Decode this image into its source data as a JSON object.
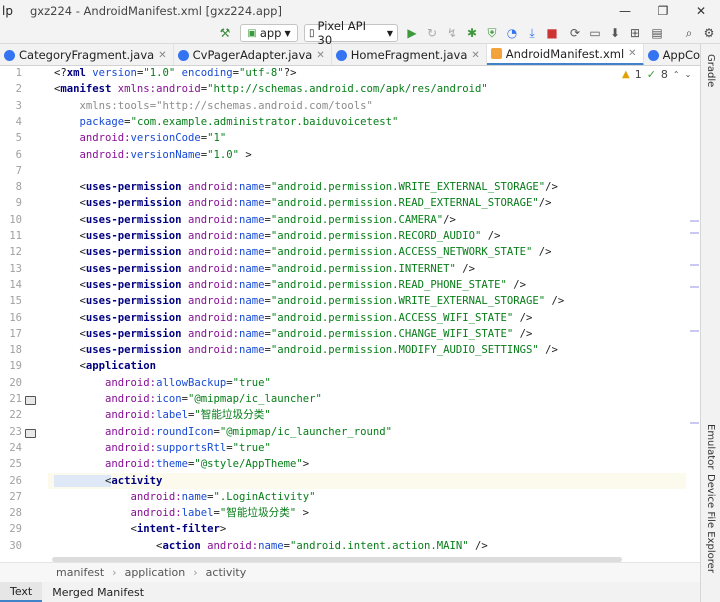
{
  "title_bar": {
    "menu_fragment": "lp",
    "window_title": "gxz224 - AndroidManifest.xml [gxz224.app]",
    "controls": [
      "minimize",
      "maximize",
      "close"
    ]
  },
  "toolbar": {
    "run_config": "app",
    "device": "Pixel API 30"
  },
  "tabs": [
    {
      "label": "CategoryFragment.java",
      "icon": "class-icon",
      "active": false
    },
    {
      "label": "CvPagerAdapter.java",
      "icon": "class-icon",
      "active": false
    },
    {
      "label": "HomeFragment.java",
      "icon": "class-icon",
      "active": false
    },
    {
      "label": "AndroidManifest.xml",
      "icon": "xml-icon",
      "active": true
    },
    {
      "label": "AppCompatPreferenceActi",
      "icon": "class-icon",
      "active": false
    }
  ],
  "right_strip": {
    "top": "Gradle",
    "emulator": "Emulator",
    "explorer": "Device File Explorer"
  },
  "inspections": {
    "warnings": "1",
    "ok": "8"
  },
  "code_lines": [
    {
      "n": "1",
      "img": false,
      "tokens": [
        [
          "p",
          "<?"
        ],
        [
          "tag",
          "xml "
        ],
        [
          "attr",
          "version"
        ],
        [
          "p",
          "="
        ],
        [
          "val",
          "\"1.0\" "
        ],
        [
          "attr",
          "encoding"
        ],
        [
          "p",
          "="
        ],
        [
          "val",
          "\"utf-8\""
        ],
        [
          "p",
          "?>"
        ]
      ]
    },
    {
      "n": "2",
      "img": false,
      "tokens": [
        [
          "p",
          "<"
        ],
        [
          "tag",
          "manifest "
        ],
        [
          "ns",
          "xmlns:android"
        ],
        [
          "p",
          "="
        ],
        [
          "val",
          "\"http://schemas.android.com/apk/res/android\""
        ]
      ]
    },
    {
      "n": "3",
      "img": false,
      "tokens": [
        [
          "p",
          "    "
        ],
        [
          "gray",
          "xmlns:tools"
        ],
        [
          "gray",
          "="
        ],
        [
          "gray",
          "\"http://schemas.android.com/tools\""
        ]
      ]
    },
    {
      "n": "4",
      "img": false,
      "tokens": [
        [
          "p",
          "    "
        ],
        [
          "attr",
          "package"
        ],
        [
          "p",
          "="
        ],
        [
          "val",
          "\"com.example.administrator.baiduvoicetest\""
        ]
      ]
    },
    {
      "n": "5",
      "img": false,
      "tokens": [
        [
          "p",
          "    "
        ],
        [
          "ns",
          "android:"
        ],
        [
          "attr",
          "versionCode"
        ],
        [
          "p",
          "="
        ],
        [
          "val",
          "\"1\""
        ]
      ]
    },
    {
      "n": "6",
      "img": false,
      "tokens": [
        [
          "p",
          "    "
        ],
        [
          "ns",
          "android:"
        ],
        [
          "attr",
          "versionName"
        ],
        [
          "p",
          "="
        ],
        [
          "val",
          "\"1.0\" "
        ],
        [
          "p",
          ">"
        ]
      ]
    },
    {
      "n": "7",
      "img": false,
      "tokens": []
    },
    {
      "n": "8",
      "img": false,
      "tokens": [
        [
          "p",
          "    <"
        ],
        [
          "tag",
          "uses-permission "
        ],
        [
          "ns",
          "android:"
        ],
        [
          "attr",
          "name"
        ],
        [
          "p",
          "="
        ],
        [
          "val",
          "\"android.permission.WRITE_EXTERNAL_STORAGE\""
        ],
        [
          "p",
          "/>"
        ]
      ]
    },
    {
      "n": "9",
      "img": false,
      "tokens": [
        [
          "p",
          "    <"
        ],
        [
          "tag",
          "uses-permission "
        ],
        [
          "ns",
          "android:"
        ],
        [
          "attr",
          "name"
        ],
        [
          "p",
          "="
        ],
        [
          "val",
          "\"android.permission.READ_EXTERNAL_STORAGE\""
        ],
        [
          "p",
          "/>"
        ]
      ]
    },
    {
      "n": "10",
      "img": false,
      "tokens": [
        [
          "p",
          "    <"
        ],
        [
          "tag",
          "uses-permission "
        ],
        [
          "ns",
          "android:"
        ],
        [
          "attr",
          "name"
        ],
        [
          "p",
          "="
        ],
        [
          "val",
          "\"android.permission.CAMERA\""
        ],
        [
          "p",
          "/>"
        ]
      ]
    },
    {
      "n": "11",
      "img": false,
      "tokens": [
        [
          "p",
          "    <"
        ],
        [
          "tag",
          "uses-permission "
        ],
        [
          "ns",
          "android:"
        ],
        [
          "attr",
          "name"
        ],
        [
          "p",
          "="
        ],
        [
          "val",
          "\"android.permission.RECORD_AUDIO\" "
        ],
        [
          "p",
          "/>"
        ]
      ]
    },
    {
      "n": "12",
      "img": false,
      "tokens": [
        [
          "p",
          "    <"
        ],
        [
          "tag",
          "uses-permission "
        ],
        [
          "ns",
          "android:"
        ],
        [
          "attr",
          "name"
        ],
        [
          "p",
          "="
        ],
        [
          "val",
          "\"android.permission.ACCESS_NETWORK_STATE\" "
        ],
        [
          "p",
          "/>"
        ]
      ]
    },
    {
      "n": "13",
      "img": false,
      "tokens": [
        [
          "p",
          "    <"
        ],
        [
          "tag",
          "uses-permission "
        ],
        [
          "ns",
          "android:"
        ],
        [
          "attr",
          "name"
        ],
        [
          "p",
          "="
        ],
        [
          "val",
          "\"android.permission.INTERNET\" "
        ],
        [
          "p",
          "/>"
        ]
      ]
    },
    {
      "n": "14",
      "img": false,
      "tokens": [
        [
          "p",
          "    <"
        ],
        [
          "tag",
          "uses-permission "
        ],
        [
          "ns",
          "android:"
        ],
        [
          "attr",
          "name"
        ],
        [
          "p",
          "="
        ],
        [
          "val",
          "\"android.permission.READ_PHONE_STATE\" "
        ],
        [
          "p",
          "/>"
        ]
      ]
    },
    {
      "n": "15",
      "img": false,
      "tokens": [
        [
          "p",
          "    <"
        ],
        [
          "tag",
          "uses-permission "
        ],
        [
          "ns",
          "android:"
        ],
        [
          "attr",
          "name"
        ],
        [
          "p",
          "="
        ],
        [
          "val",
          "\"android.permission.WRITE_EXTERNAL_STORAGE\" "
        ],
        [
          "p",
          "/>"
        ]
      ]
    },
    {
      "n": "16",
      "img": false,
      "tokens": [
        [
          "p",
          "    <"
        ],
        [
          "tag",
          "uses-permission "
        ],
        [
          "ns",
          "android:"
        ],
        [
          "attr",
          "name"
        ],
        [
          "p",
          "="
        ],
        [
          "val",
          "\"android.permission.ACCESS_WIFI_STATE\" "
        ],
        [
          "p",
          "/>"
        ]
      ]
    },
    {
      "n": "17",
      "img": false,
      "tokens": [
        [
          "p",
          "    <"
        ],
        [
          "tag",
          "uses-permission "
        ],
        [
          "ns",
          "android:"
        ],
        [
          "attr",
          "name"
        ],
        [
          "p",
          "="
        ],
        [
          "val",
          "\"android.permission.CHANGE_WIFI_STATE\" "
        ],
        [
          "p",
          "/>"
        ]
      ]
    },
    {
      "n": "18",
      "img": false,
      "tokens": [
        [
          "p",
          "    <"
        ],
        [
          "tag",
          "uses-permission "
        ],
        [
          "ns",
          "android:"
        ],
        [
          "attr",
          "name"
        ],
        [
          "p",
          "="
        ],
        [
          "val",
          "\"android.permission.MODIFY_AUDIO_SETTINGS\" "
        ],
        [
          "p",
          "/>"
        ]
      ]
    },
    {
      "n": "19",
      "img": false,
      "tokens": [
        [
          "p",
          "    <"
        ],
        [
          "tag",
          "application"
        ]
      ]
    },
    {
      "n": "20",
      "img": false,
      "tokens": [
        [
          "p",
          "        "
        ],
        [
          "ns",
          "android:"
        ],
        [
          "attr",
          "allowBackup"
        ],
        [
          "p",
          "="
        ],
        [
          "val",
          "\"true\""
        ]
      ]
    },
    {
      "n": "21",
      "img": true,
      "tokens": [
        [
          "p",
          "        "
        ],
        [
          "ns",
          "android:"
        ],
        [
          "attr",
          "icon"
        ],
        [
          "p",
          "="
        ],
        [
          "val",
          "\"@mipmap/ic_launcher\""
        ]
      ]
    },
    {
      "n": "22",
      "img": false,
      "tokens": [
        [
          "p",
          "        "
        ],
        [
          "ns",
          "android:"
        ],
        [
          "attr",
          "label"
        ],
        [
          "p",
          "="
        ],
        [
          "val",
          "\"智能垃圾分类\""
        ]
      ]
    },
    {
      "n": "23",
      "img": true,
      "tokens": [
        [
          "p",
          "        "
        ],
        [
          "ns",
          "android:"
        ],
        [
          "attr",
          "roundIcon"
        ],
        [
          "p",
          "="
        ],
        [
          "val",
          "\"@mipmap/ic_launcher_round\""
        ]
      ]
    },
    {
      "n": "24",
      "img": false,
      "tokens": [
        [
          "p",
          "        "
        ],
        [
          "ns",
          "android:"
        ],
        [
          "attr",
          "supportsRtl"
        ],
        [
          "p",
          "="
        ],
        [
          "val",
          "\"true\""
        ]
      ]
    },
    {
      "n": "25",
      "img": false,
      "tokens": [
        [
          "p",
          "        "
        ],
        [
          "ns",
          "android:"
        ],
        [
          "attr",
          "theme"
        ],
        [
          "p",
          "="
        ],
        [
          "val",
          "\"@style/AppTheme\""
        ],
        [
          "p",
          ">"
        ]
      ]
    },
    {
      "n": "26",
      "img": false,
      "cur": true,
      "tokens": [
        [
          "p",
          "        <"
        ],
        [
          "tag",
          "activity"
        ]
      ]
    },
    {
      "n": "27",
      "img": false,
      "tokens": [
        [
          "p",
          "            "
        ],
        [
          "ns",
          "android:"
        ],
        [
          "attr",
          "name"
        ],
        [
          "p",
          "="
        ],
        [
          "val",
          "\".LoginActivity\""
        ]
      ]
    },
    {
      "n": "28",
      "img": false,
      "tokens": [
        [
          "p",
          "            "
        ],
        [
          "ns",
          "android:"
        ],
        [
          "attr",
          "label"
        ],
        [
          "p",
          "="
        ],
        [
          "val",
          "\"智能垃圾分类\" "
        ],
        [
          "p",
          ">"
        ]
      ]
    },
    {
      "n": "29",
      "img": false,
      "tokens": [
        [
          "p",
          "            <"
        ],
        [
          "tag",
          "intent-filter"
        ],
        [
          "p",
          ">"
        ]
      ]
    },
    {
      "n": "30",
      "img": false,
      "tokens": [
        [
          "p",
          "                <"
        ],
        [
          "tag",
          "action "
        ],
        [
          "ns",
          "android:"
        ],
        [
          "attr",
          "name"
        ],
        [
          "p",
          "="
        ],
        [
          "val",
          "\"android.intent.action.MAIN\" "
        ],
        [
          "p",
          "/>"
        ]
      ]
    }
  ],
  "breadcrumb": [
    "manifest",
    "application",
    "activity"
  ],
  "bottom_tabs": [
    {
      "label": "Text",
      "active": true
    },
    {
      "label": "Merged Manifest",
      "active": false
    }
  ],
  "colors": {
    "accent": "#4083c9",
    "tag": "#000080",
    "attr": "#174ad4",
    "namespace": "#871094",
    "string": "#067d17"
  }
}
